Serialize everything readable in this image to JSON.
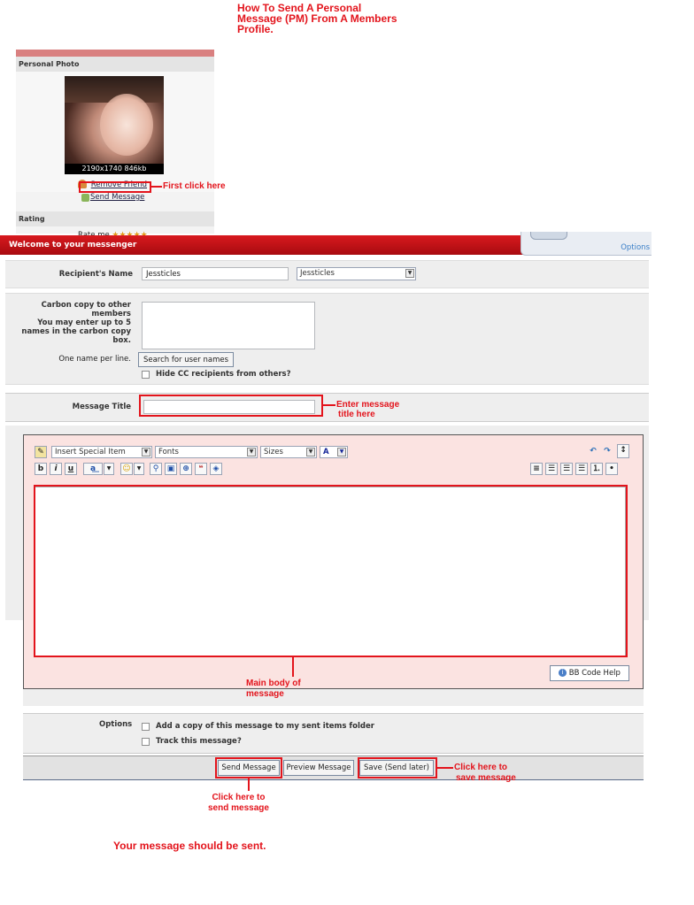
{
  "tutorial": {
    "title_lines": [
      "How To Send A Personal",
      "Message (PM) From A Members",
      "Profile."
    ],
    "first_click": "First click here",
    "enter_title_lines": [
      "Enter message",
      "title here"
    ],
    "main_body_lines": [
      "Main body of",
      "message"
    ],
    "click_send_lines": [
      "Click here to",
      "send message"
    ],
    "click_save_lines": [
      "Click here to",
      "save message"
    ],
    "final_note": "Your message should be sent."
  },
  "profile": {
    "photo_header": "Personal Photo",
    "photo_caption": "2190x1740 846kb",
    "remove_friend": "Remove Friend",
    "send_message": "Send Message",
    "rating_header": "Rating",
    "rate_me": "Rate me",
    "stars": "★★★★★"
  },
  "messenger": {
    "header_title": "Welcome to your messenger",
    "options_link": "Options",
    "recipient_label": "Recipient's Name",
    "recipient_value": "Jessticles",
    "recipient_select": "Jessticles",
    "cc_label_lines": [
      "Carbon copy to other",
      "members",
      "You may enter up to 5",
      "names in the carbon copy",
      "box."
    ],
    "one_name_label": "One name per line.",
    "search_button": "Search for user names",
    "hide_cc_label": "Hide CC recipients from others?",
    "message_title_label": "Message Title",
    "message_title_value": ""
  },
  "editor": {
    "special_item": "Insert Special Item",
    "fonts": "Fonts",
    "sizes": "Sizes",
    "color_glyph": "A",
    "bold": "b",
    "italic": "i",
    "underline": "u",
    "bb_help": "BB Code Help",
    "body_value": ""
  },
  "options": {
    "label": "Options",
    "copy_sent": "Add a copy of this message to my sent items folder",
    "track": "Track this message?"
  },
  "actions": {
    "send": "Send Message",
    "preview": "Preview Message",
    "save": "Save (Send later)"
  }
}
